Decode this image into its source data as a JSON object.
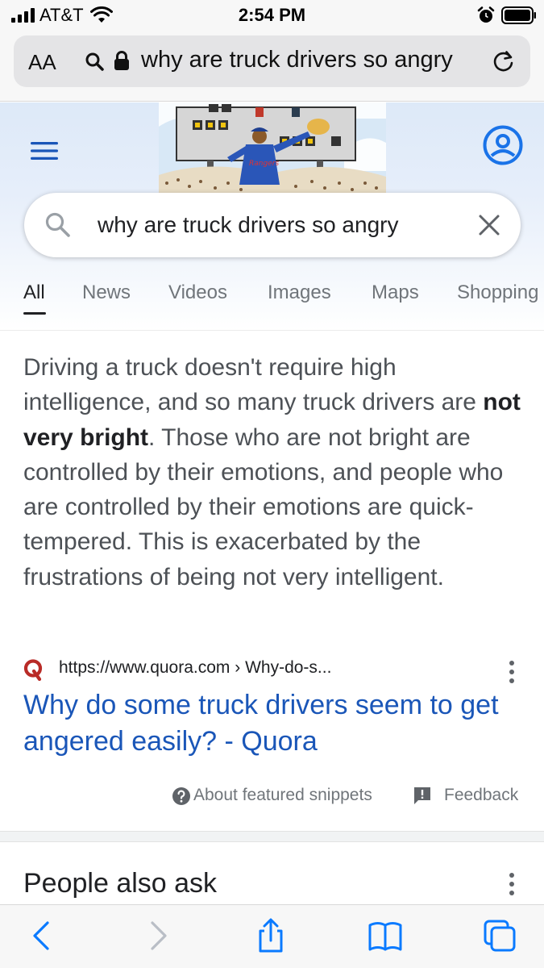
{
  "status_bar": {
    "carrier": "AT&T",
    "time": "2:54 PM"
  },
  "address_bar": {
    "text_size_label": "AA",
    "url_text": "why are truck drivers so angry"
  },
  "google": {
    "search_query": "why are truck drivers so angry",
    "tabs": [
      {
        "label": "All",
        "active": true
      },
      {
        "label": "News"
      },
      {
        "label": "Videos"
      },
      {
        "label": "Images"
      },
      {
        "label": "Maps"
      },
      {
        "label": "Shopping"
      }
    ]
  },
  "featured_snippet": {
    "text_before": "Driving a truck doesn't require high intelligence, and so many truck drivers are ",
    "text_bold": "not very bright",
    "text_after": ". Those who are not bright are controlled by their emotions, and people who are controlled by their emotions are quick-tempered. This is exacerbated by the frustrations of being not very intelligent.",
    "source_url": "https://www.quora.com › Why-do-s...",
    "result_title": "Why do some truck drivers seem to get angered easily? - Quora",
    "about_label": "About featured snippets",
    "feedback_label": "Feedback"
  },
  "people_also_ask": {
    "heading": "People also ask"
  },
  "colors": {
    "link_blue": "#1a56b8",
    "accent_blue": "#1a73e8",
    "quora_red": "#b92b27",
    "safari_blue": "#0a7aff"
  }
}
